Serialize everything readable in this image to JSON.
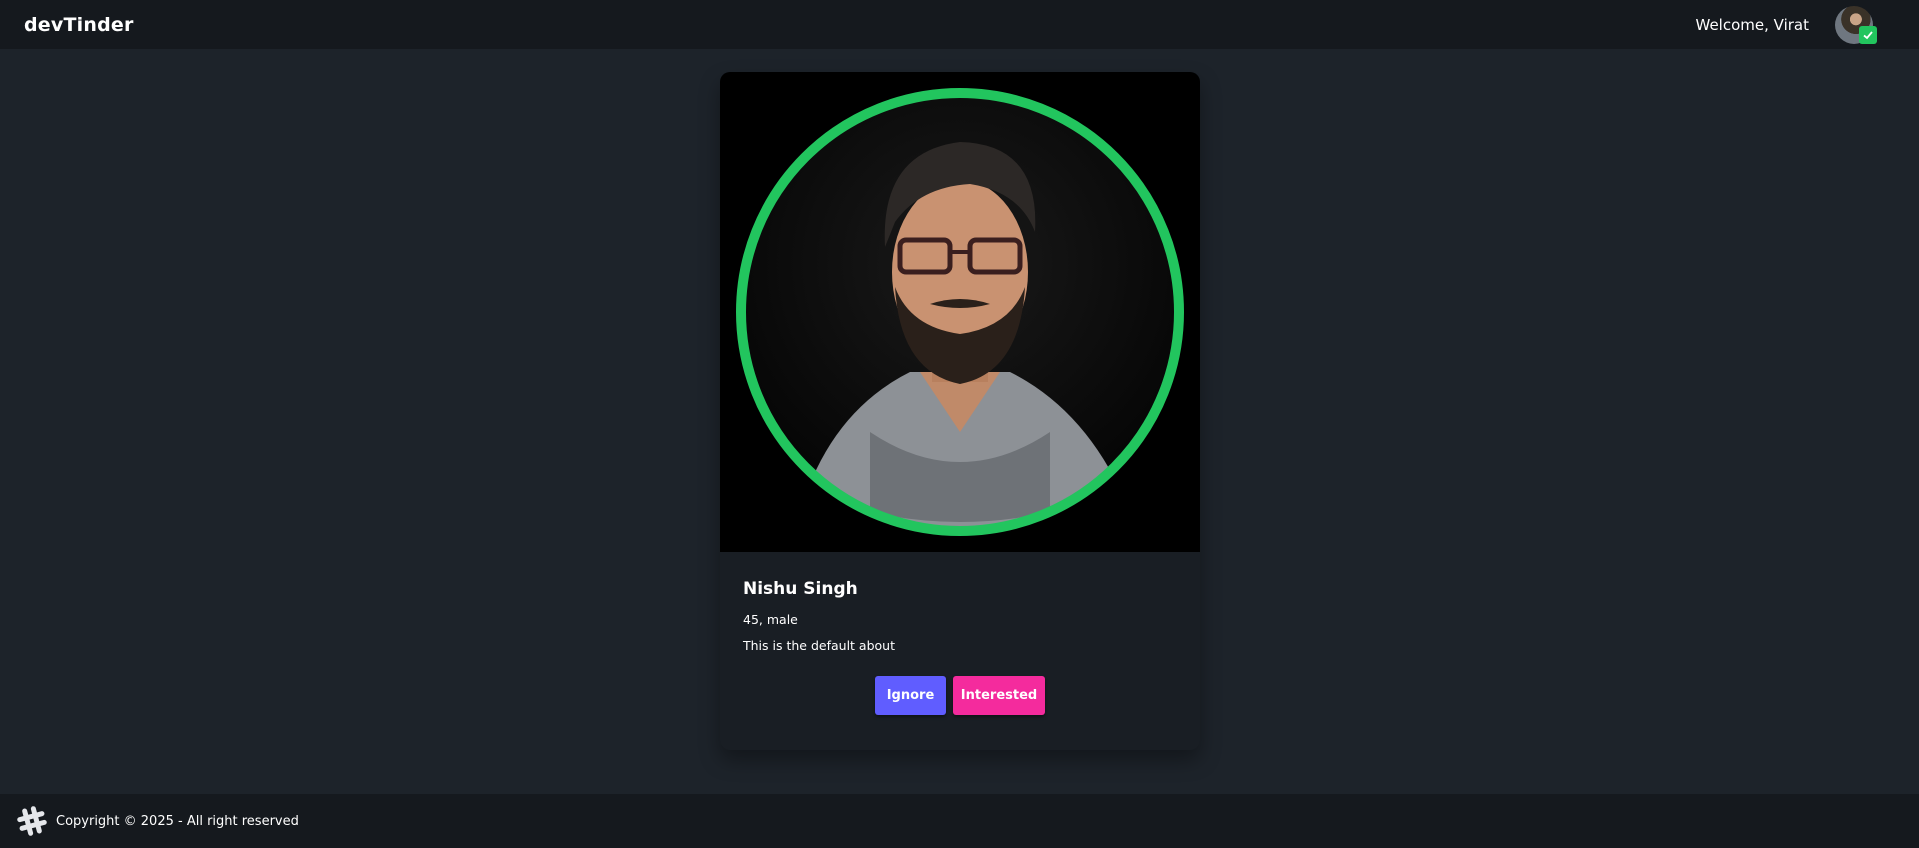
{
  "navbar": {
    "brand": "devTinder",
    "welcome": "Welcome, Virat",
    "avatar_icon": "user-avatar",
    "badge_icon": "check-icon"
  },
  "card": {
    "photo_icon": "profile-photo",
    "name": "Nishu Singh",
    "info": "45, male",
    "about": "This is the default about",
    "ring_color": "#22c55e",
    "buttons": {
      "ignore_label": "Ignore",
      "interested_label": "Interested"
    }
  },
  "footer": {
    "icon": "hashtag-icon",
    "text": "Copyright © 2025 - All right reserved"
  },
  "colors": {
    "background": "#1d232a",
    "navbar": "#15191e",
    "card": "#191e24",
    "ignore": "#605dff",
    "interested": "#f42b9d"
  }
}
